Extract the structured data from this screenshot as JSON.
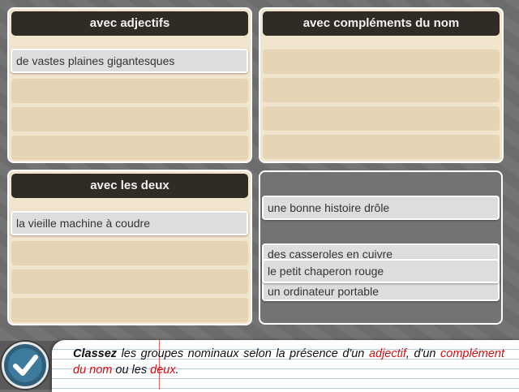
{
  "panels": {
    "adjectifs": {
      "title": "avec adjectifs",
      "cards": [
        "de vastes plaines gigantesques"
      ]
    },
    "complements": {
      "title": "avec compléments du nom",
      "cards": []
    },
    "deux": {
      "title": "avec les deux",
      "cards": [
        "la vieille machine à coudre"
      ]
    }
  },
  "pool": {
    "cards": [
      "une bonne histoire drôle",
      "des casseroles en cuivre",
      "un ordinateur portable",
      "le petit chaperon rouge"
    ]
  },
  "instruction": {
    "bold": "Classez",
    "t1": " les groupes nominaux selon la présence d'un ",
    "r1": "adjectif",
    "t2": ", d'un ",
    "r2": "complément du nom",
    "t3": " ou les ",
    "r3": "deux",
    "t4": "."
  },
  "icons": {
    "check": "check-icon"
  },
  "colors": {
    "panel_bg": "#f1e5cd",
    "header_bg": "#302c25",
    "card_bg": "#dddddd",
    "accent_red": "#d60f0f",
    "check_blue": "#3e7a9c"
  }
}
